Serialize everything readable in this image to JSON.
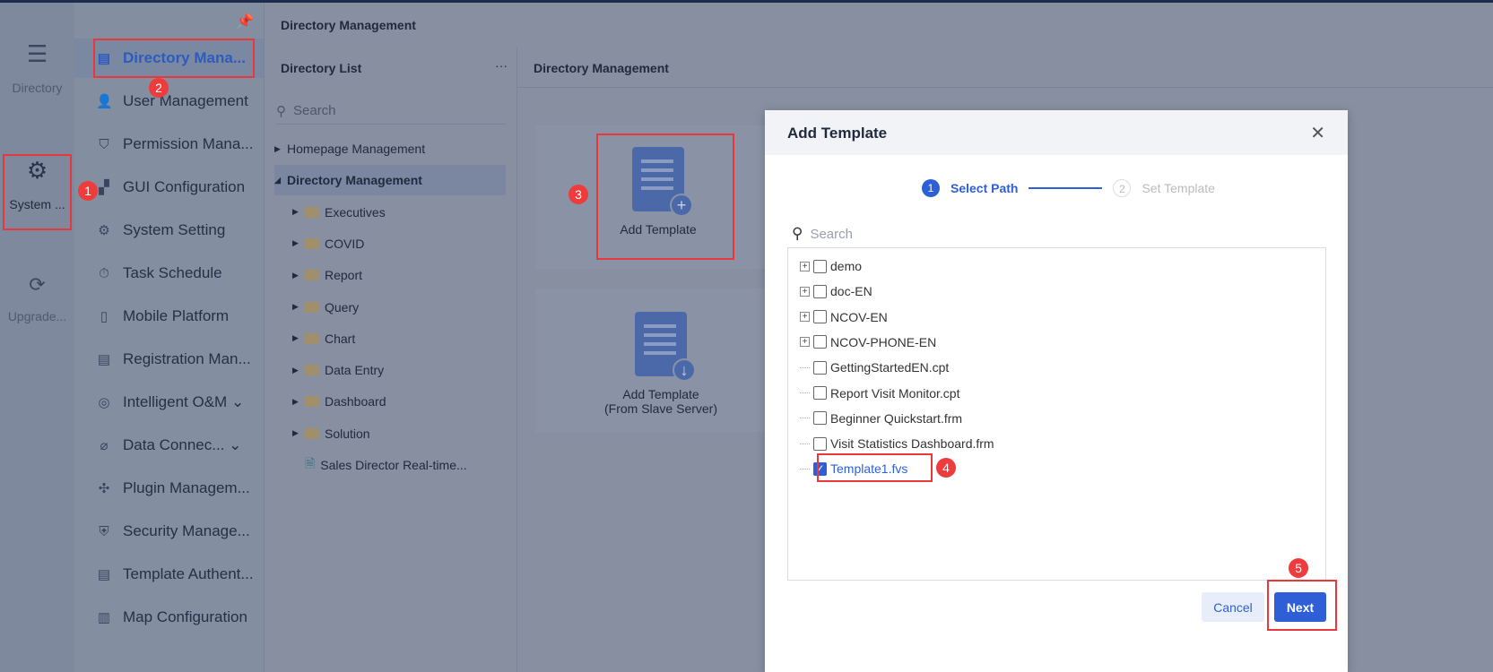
{
  "rail": [
    {
      "label": "Directory",
      "icon": "list-icon"
    },
    {
      "label": "System ...",
      "icon": "gear-icon"
    },
    {
      "label": "Upgrade...",
      "icon": "nodes-icon"
    }
  ],
  "menu": [
    {
      "label": "Directory Mana...",
      "icon": "▤"
    },
    {
      "label": "User Management",
      "icon": "👤"
    },
    {
      "label": "Permission Mana...",
      "icon": "⛉"
    },
    {
      "label": "GUI Configuration",
      "icon": "▞"
    },
    {
      "label": "System Setting",
      "icon": "⚙"
    },
    {
      "label": "Task Schedule",
      "icon": "⏱"
    },
    {
      "label": "Mobile Platform",
      "icon": "▯"
    },
    {
      "label": "Registration Man...",
      "icon": "▤"
    },
    {
      "label": "Intelligent O&M ⌄",
      "icon": "◎"
    },
    {
      "label": "Data Connec... ⌄",
      "icon": "⌀"
    },
    {
      "label": "Plugin Managem...",
      "icon": "✣"
    },
    {
      "label": "Security Manage...",
      "icon": "⛨"
    },
    {
      "label": "Template Authent...",
      "icon": "▤"
    },
    {
      "label": "Map Configuration",
      "icon": "▥"
    }
  ],
  "header": {
    "title": "Directory Management"
  },
  "dirlist": {
    "title": "Directory List",
    "more": "···",
    "search_placeholder": "Search",
    "items": [
      {
        "label": "Homepage Management",
        "level": 0,
        "type": "collapsed"
      },
      {
        "label": "Directory Management",
        "level": 0,
        "type": "expanded"
      },
      {
        "label": "Executives",
        "level": 1,
        "type": "folder"
      },
      {
        "label": "COVID",
        "level": 1,
        "type": "folder"
      },
      {
        "label": "Report",
        "level": 1,
        "type": "folder"
      },
      {
        "label": "Query",
        "level": 1,
        "type": "folder"
      },
      {
        "label": "Chart",
        "level": 1,
        "type": "folder"
      },
      {
        "label": "Data Entry",
        "level": 1,
        "type": "folder"
      },
      {
        "label": "Dashboard",
        "level": 1,
        "type": "folder"
      },
      {
        "label": "Solution",
        "level": 1,
        "type": "folder"
      },
      {
        "label": "Sales Director Real-time...",
        "level": 1,
        "type": "file"
      }
    ]
  },
  "main": {
    "title": "Directory Management",
    "card1": "Add Template",
    "card2_line1": "Add Template",
    "card2_line2": "(From Slave Server)"
  },
  "dialog": {
    "title": "Add Template",
    "close": "✕",
    "step1_num": "1",
    "step1": "Select Path",
    "step2_num": "2",
    "step2": "Set Template",
    "search_placeholder": "Search",
    "tree": [
      {
        "label": "demo",
        "expandable": true,
        "checked": false
      },
      {
        "label": "doc-EN",
        "expandable": true,
        "checked": false
      },
      {
        "label": "NCOV-EN",
        "expandable": true,
        "checked": false
      },
      {
        "label": "NCOV-PHONE-EN",
        "expandable": true,
        "checked": false
      },
      {
        "label": "GettingStartedEN.cpt",
        "expandable": false,
        "checked": false
      },
      {
        "label": "Report Visit Monitor.cpt",
        "expandable": false,
        "checked": false
      },
      {
        "label": "Beginner Quickstart.frm",
        "expandable": false,
        "checked": false
      },
      {
        "label": "Visit Statistics Dashboard.frm",
        "expandable": false,
        "checked": false
      },
      {
        "label": "Template1.fvs",
        "expandable": false,
        "checked": true
      }
    ],
    "cancel": "Cancel",
    "next": "Next"
  },
  "annotations": [
    "1",
    "2",
    "3",
    "4",
    "5"
  ],
  "colors": {
    "accent": "#2e5fd6",
    "annotation": "#e8383d"
  }
}
